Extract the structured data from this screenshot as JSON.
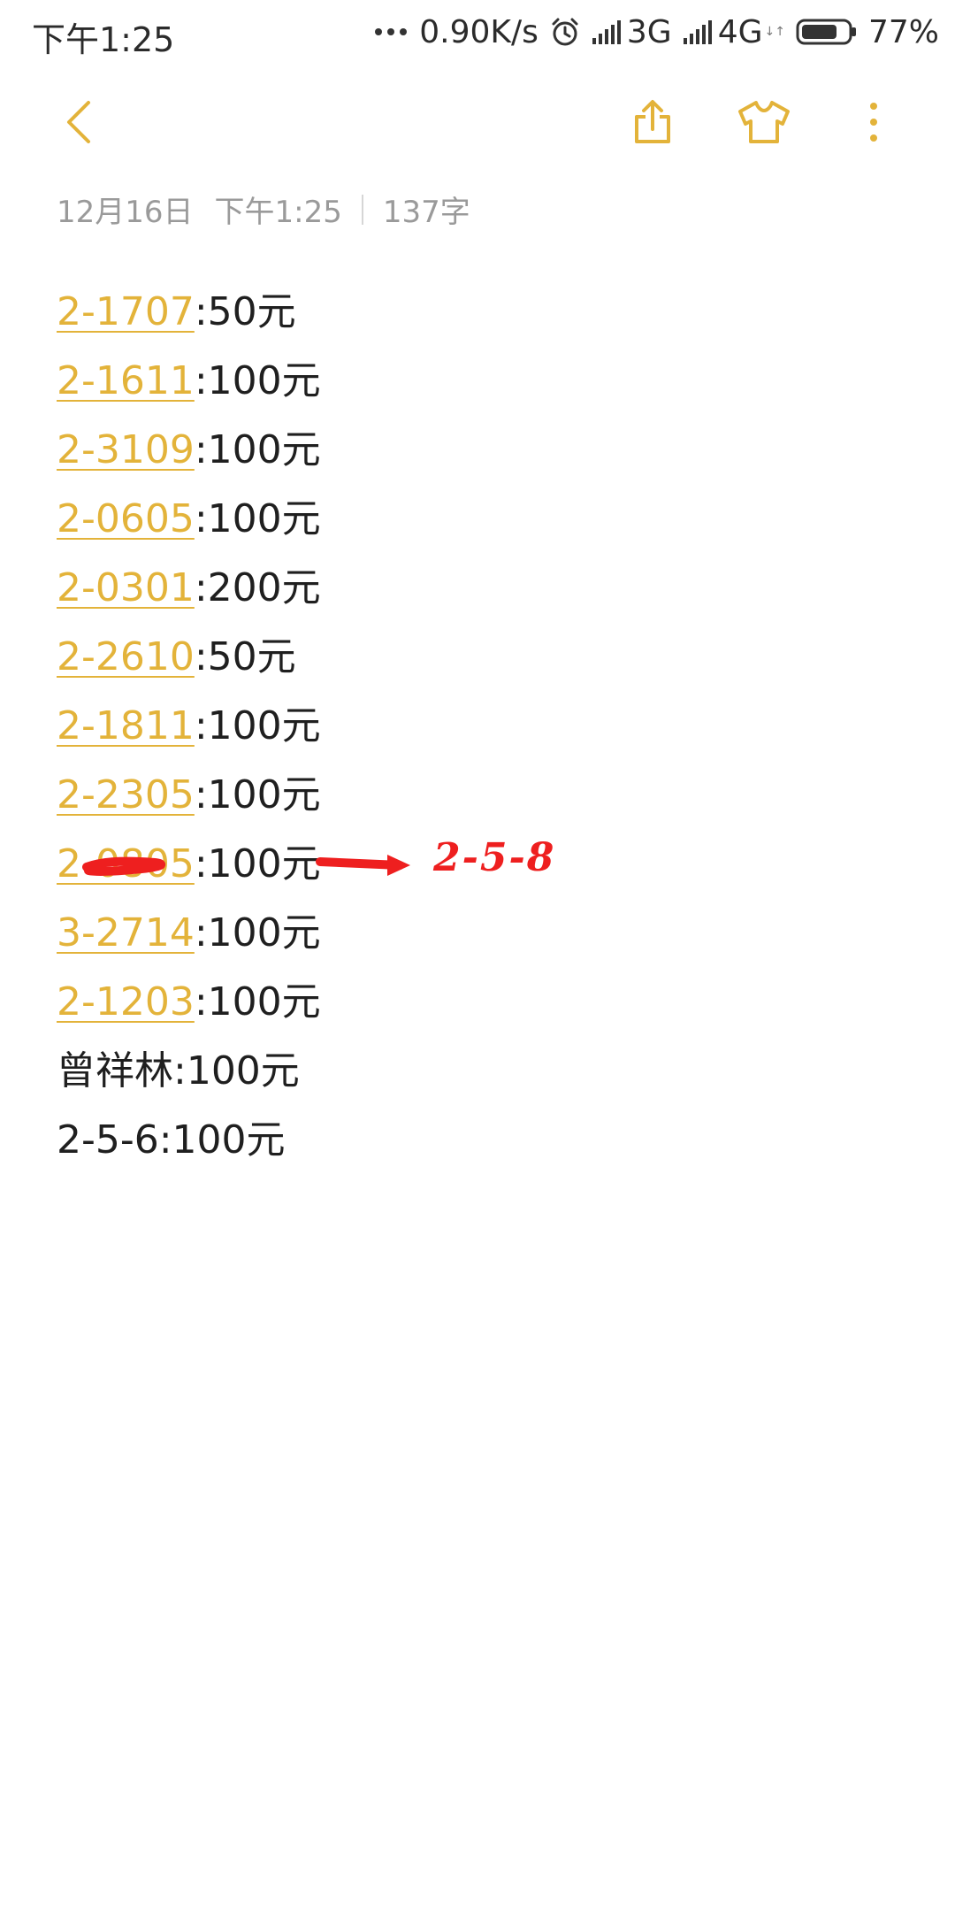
{
  "status_bar": {
    "time": "下午1:25",
    "net_speed": "0.90K/s",
    "sim1_label": "3G",
    "sim2_label": "4G",
    "sim2_sub": "↓↑",
    "battery_percent": "77%",
    "battery_level": 0.77,
    "icons": [
      "more-dots-icon",
      "alarm-clock-icon",
      "signal-icon",
      "signal-icon",
      "battery-icon"
    ]
  },
  "toolbar": {
    "icons": [
      "back-arrow-icon",
      "share-icon",
      "theme-shirt-icon",
      "more-vertical-icon"
    ]
  },
  "meta": {
    "date": "12月16日",
    "time": "下午1:25",
    "word_count": "137字"
  },
  "note": {
    "lines": [
      {
        "link": "2-1707",
        "text": ":50元"
      },
      {
        "link": "2-1611",
        "text": ":100元"
      },
      {
        "link": "2-3109",
        "text": ":100元"
      },
      {
        "link": "2-0605",
        "text": ":100元"
      },
      {
        "link": "2-0301",
        "text": ":200元"
      },
      {
        "link": "2-2610",
        "text": ":50元"
      },
      {
        "link": "2-1811",
        "text": ":100元"
      },
      {
        "link": "2-2305",
        "text": ":100元"
      },
      {
        "link": "2-0805",
        "text": ":100元"
      },
      {
        "link": "3-2714",
        "text": ":100元"
      },
      {
        "link": "2-1203",
        "text": ":100元"
      },
      {
        "link": "",
        "text": "曾祥林:100元"
      },
      {
        "link": "",
        "text": "2-5-6:100元"
      }
    ]
  },
  "annotation": {
    "text": "2-5-8",
    "color": "#ee1f1f"
  },
  "colors": {
    "accent": "#e3b33a",
    "body_text": "#1f1f1f",
    "meta_text": "#9a9a9a"
  }
}
